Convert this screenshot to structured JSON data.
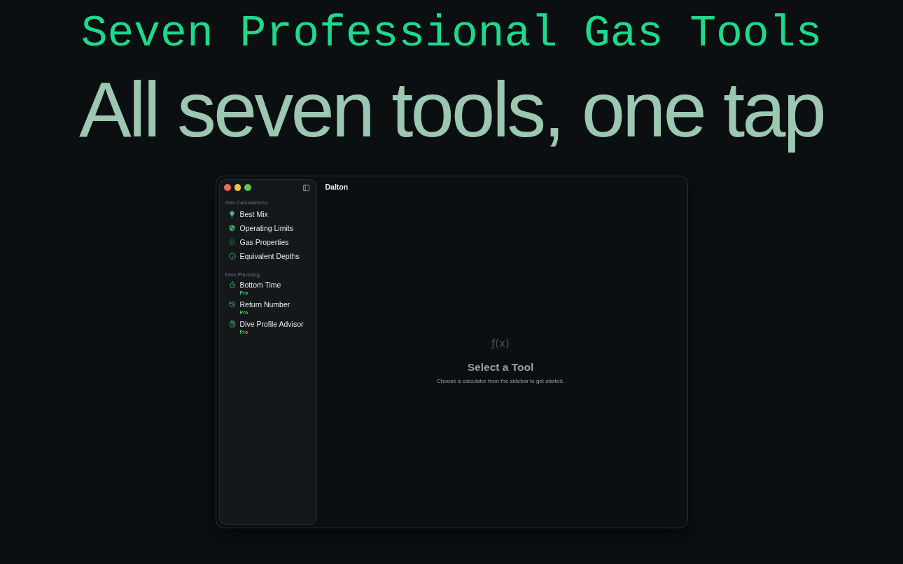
{
  "headline": "Seven Professional Gas Tools",
  "subheadline": "All seven tools, one tap",
  "window": {
    "title": "Dalton",
    "sidebar": {
      "sections": [
        {
          "header": "Gas Calculations",
          "items": [
            {
              "label": "Best Mix"
            },
            {
              "label": "Operating Limits"
            },
            {
              "label": "Gas Properties"
            },
            {
              "label": "Equivalent Depths"
            }
          ]
        },
        {
          "header": "Dive Planning",
          "items": [
            {
              "label": "Bottom Time",
              "badge": "Pro"
            },
            {
              "label": "Return Number",
              "badge": "Pro"
            },
            {
              "label": "Dive Profile Advisor",
              "badge": "Pro"
            }
          ]
        }
      ]
    },
    "empty_state": {
      "glyph": "ƒ(x)",
      "title": "Select a Tool",
      "message": "Choose a calculator from the sidebar to get started."
    }
  }
}
